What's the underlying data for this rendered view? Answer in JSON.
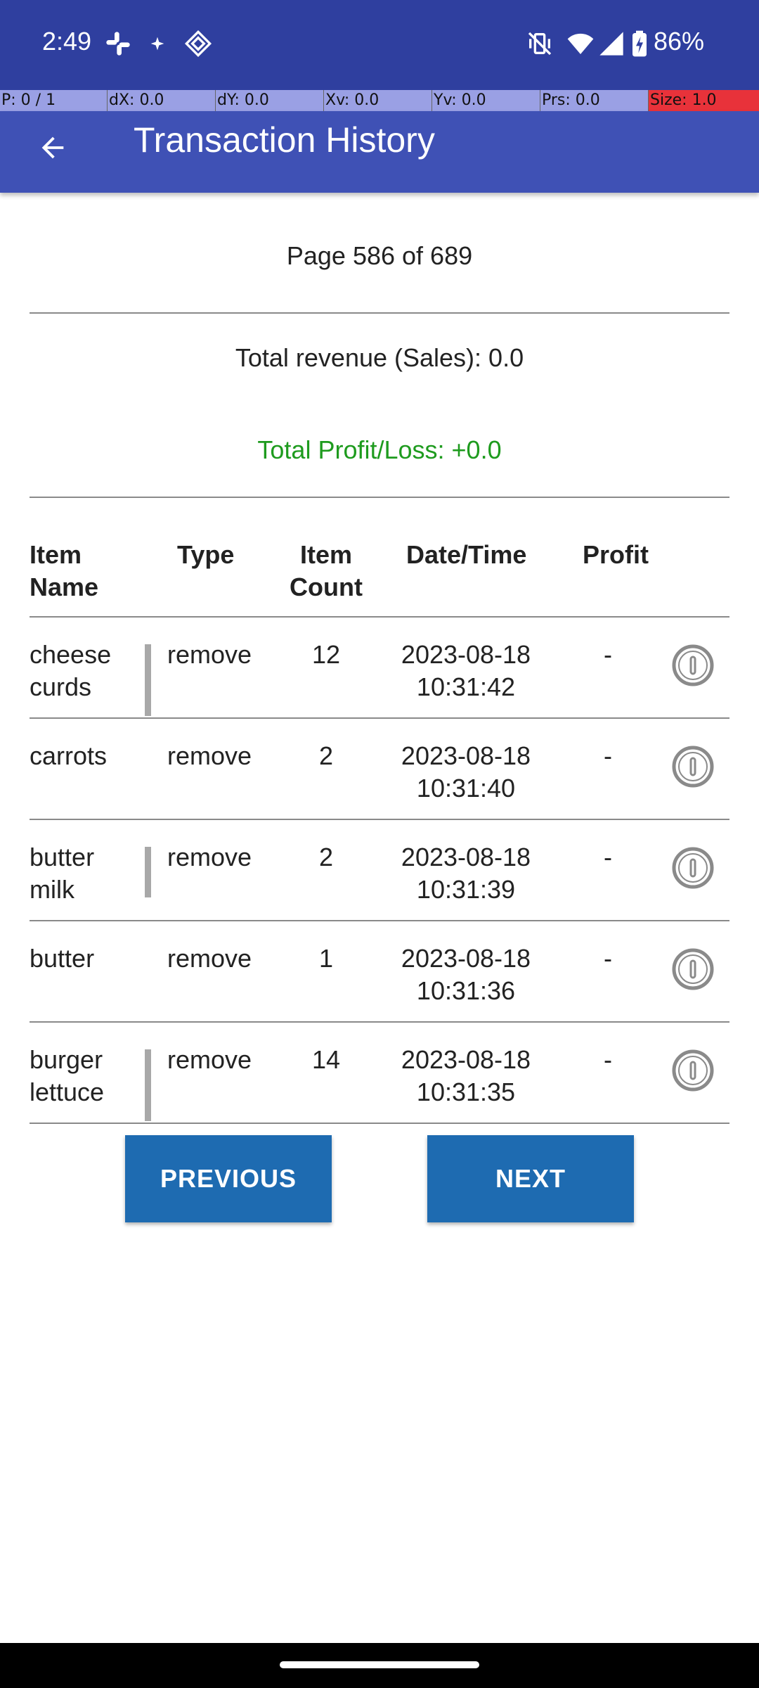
{
  "status_bar": {
    "time": "2:49",
    "battery": "86%",
    "icons": [
      "slack-icon",
      "sparkle-icon",
      "diamond-app-icon",
      "vibrate-off-icon",
      "wifi-icon",
      "signal-icon",
      "battery-charging-icon"
    ]
  },
  "pointer_overlay": {
    "p": "P: 0 / 1",
    "dx": "dX: 0.0",
    "dy": "dY: 0.0",
    "xv": "Xv: 0.0",
    "yv": "Yv: 0.0",
    "prs": "Prs: 0.0",
    "size": "Size: 1.0"
  },
  "app_bar": {
    "title": "Transaction History",
    "back_icon": "arrow-back-icon"
  },
  "summary": {
    "page_indicator": "Page 586 of 689",
    "revenue": "Total revenue (Sales): 0.0",
    "profit_loss": "Total Profit/Loss: +0.0"
  },
  "table": {
    "headers": {
      "item_name": [
        "Item",
        "Name"
      ],
      "type": "Type",
      "item_count": [
        "Item",
        "Count"
      ],
      "datetime": "Date/Time",
      "profit": "Profit"
    },
    "rows": [
      {
        "name": [
          "cheese",
          "curds"
        ],
        "type": "remove",
        "count": "12",
        "date": "2023-08-18",
        "time": "10:31:42",
        "profit": "-"
      },
      {
        "name": [
          "carrots",
          ""
        ],
        "type": "remove",
        "count": "2",
        "date": "2023-08-18",
        "time": "10:31:40",
        "profit": "-"
      },
      {
        "name": [
          "butter",
          "milk"
        ],
        "type": "remove",
        "count": "2",
        "date": "2023-08-18",
        "time": "10:31:39",
        "profit": "-"
      },
      {
        "name": [
          "butter",
          ""
        ],
        "type": "remove",
        "count": "1",
        "date": "2023-08-18",
        "time": "10:31:36",
        "profit": "-"
      },
      {
        "name": [
          "burger",
          "lettuce"
        ],
        "type": "remove",
        "count": "14",
        "date": "2023-08-18",
        "time": "10:31:35",
        "profit": "-"
      }
    ]
  },
  "pagination": {
    "previous_label": "PREVIOUS",
    "next_label": "NEXT"
  },
  "colors": {
    "status_bar": "#2f3f9f",
    "app_bar": "#3f51b5",
    "button": "#1e6bb1",
    "profit_text": "#1e9b1e"
  }
}
